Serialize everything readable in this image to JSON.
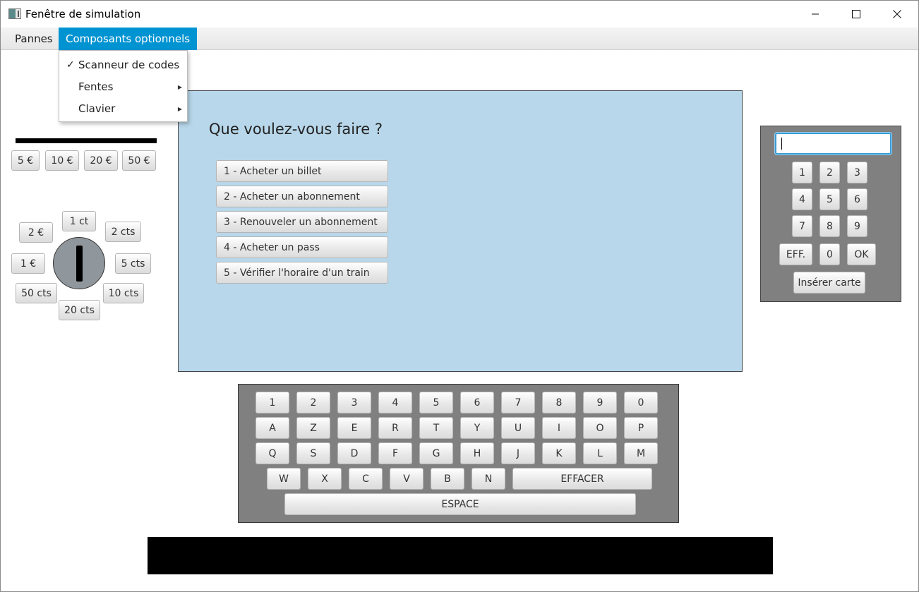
{
  "window": {
    "title": "Fenêtre de simulation",
    "minimize": "—",
    "maximize": "☐",
    "close": "✕"
  },
  "menubar": {
    "items": [
      "Pannes",
      "Composants optionnels"
    ],
    "active_index": 1
  },
  "dropdown": {
    "items": [
      {
        "label": "Scanneur de codes",
        "checked": true,
        "check": "✓",
        "submenu": false
      },
      {
        "label": "Fentes",
        "checked": false,
        "check": "",
        "submenu": true,
        "arrow": "▶"
      },
      {
        "label": "Clavier",
        "checked": false,
        "check": "",
        "submenu": true,
        "arrow": "▶"
      }
    ]
  },
  "bills": [
    "5 €",
    "10 €",
    "20 €",
    "50 €"
  ],
  "coins": {
    "c1ct": "1 ct",
    "c2eur": "2 €",
    "c2cts": "2 cts",
    "c1eur": "1 €",
    "c5cts": "5 cts",
    "c50cts": "50 cts",
    "c10cts": "10 cts",
    "c20cts": "20 cts"
  },
  "screen": {
    "question": "Que voulez-vous faire ?",
    "options": [
      "1 - Acheter un billet",
      "2 - Acheter un abonnement",
      "3 - Renouveler un abonnement",
      "4 - Acheter un pass",
      "5 - Vérifier l'horaire d'un train"
    ]
  },
  "card_panel": {
    "pin_value": "",
    "keys_row1": [
      "1",
      "2",
      "3"
    ],
    "keys_row2": [
      "4",
      "5",
      "6"
    ],
    "keys_row3": [
      "7",
      "8",
      "9"
    ],
    "keys_row4": [
      "EFF.",
      "0",
      "OK"
    ],
    "insert_card": "Insérer carte"
  },
  "keyboard": {
    "row1": [
      "1",
      "2",
      "3",
      "4",
      "5",
      "6",
      "7",
      "8",
      "9",
      "0"
    ],
    "row2": [
      "A",
      "Z",
      "E",
      "R",
      "T",
      "Y",
      "U",
      "I",
      "O",
      "P"
    ],
    "row3": [
      "Q",
      "S",
      "D",
      "F",
      "G",
      "H",
      "J",
      "K",
      "L",
      "M"
    ],
    "row4": [
      "W",
      "X",
      "C",
      "V",
      "B",
      "N"
    ],
    "erase": "EFFACER",
    "space": "ESPACE"
  },
  "colors": {
    "menu_active": "#0093d1",
    "screen_bg": "#b8d7ea",
    "panel_bg": "#808080",
    "coin_slot": "#8f969c"
  }
}
